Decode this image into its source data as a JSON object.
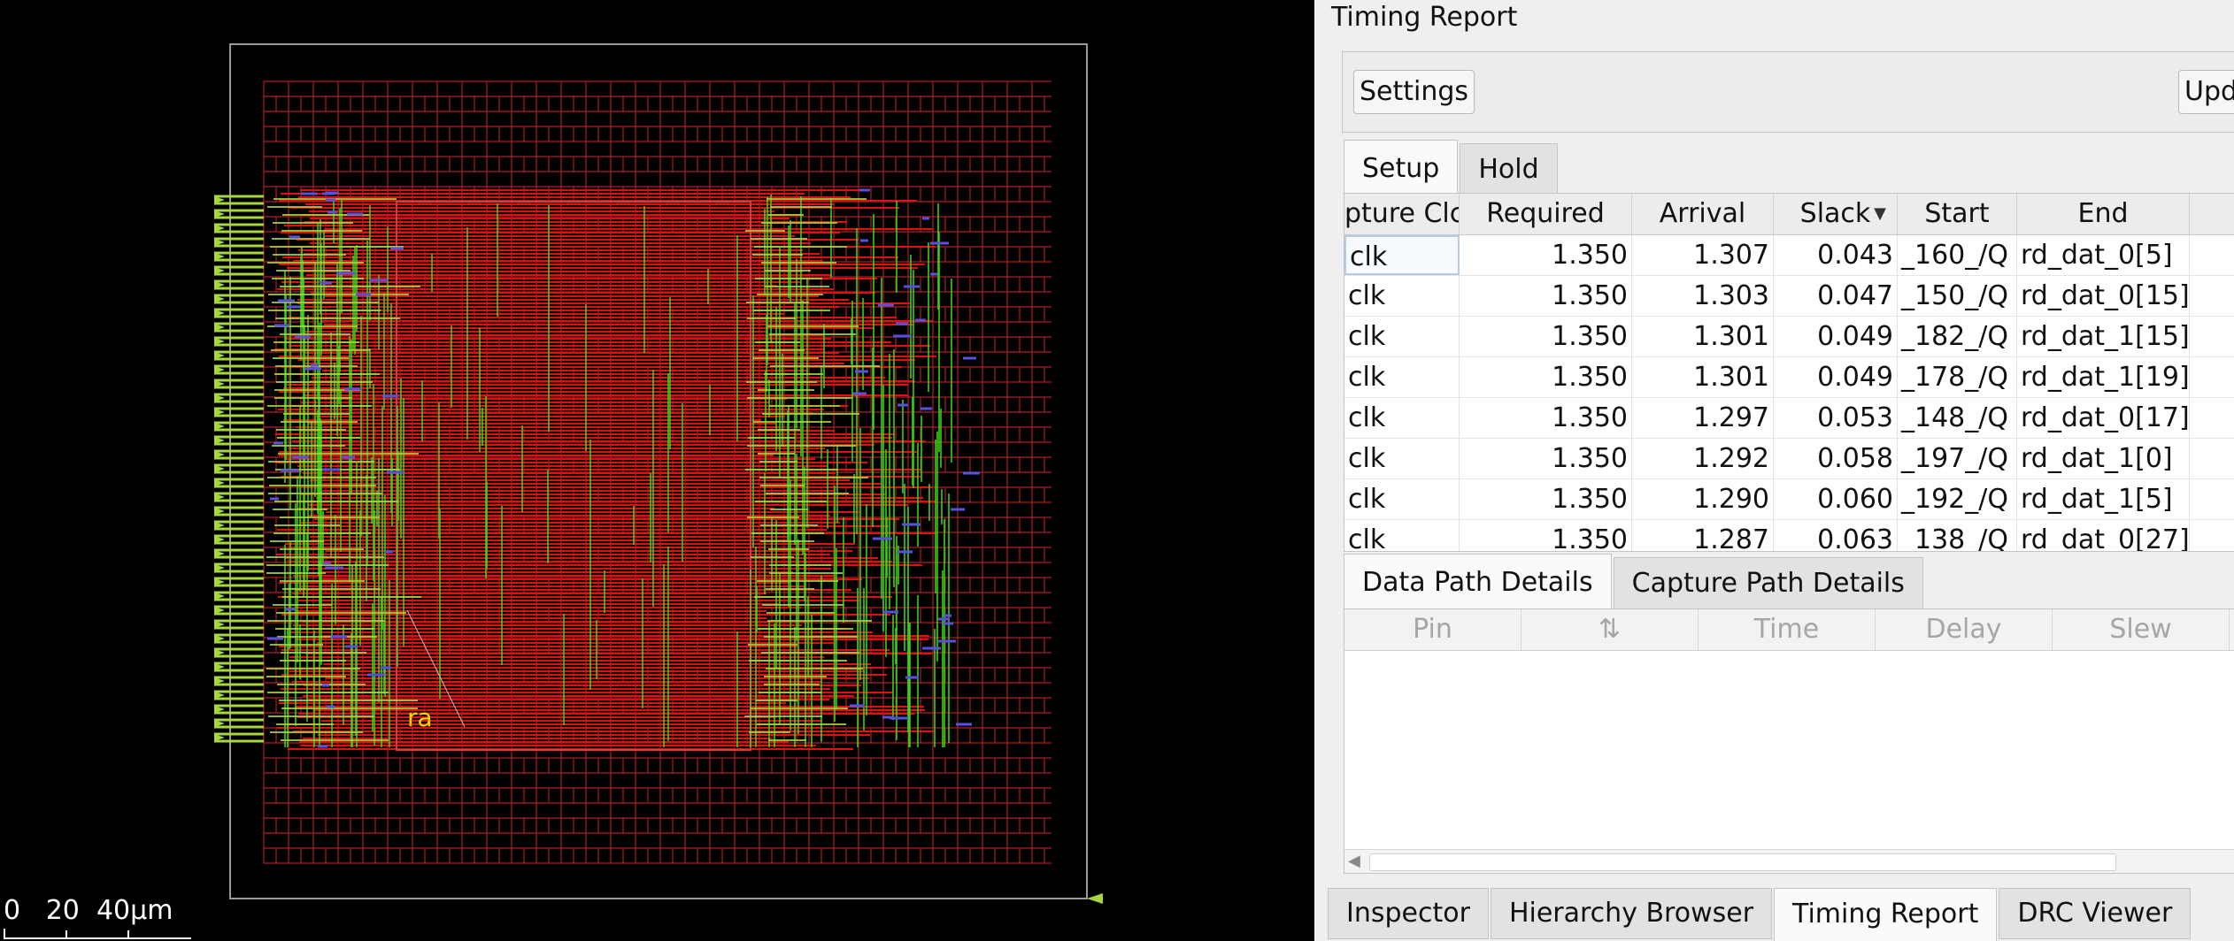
{
  "layout_view": {
    "label_text": "ra",
    "scale_label": "0   20  40μm"
  },
  "timing_report": {
    "title": "Timing Report",
    "settings_label": "Settings",
    "update_label": "Updat",
    "path_tabs": [
      {
        "label": "Setup",
        "active": true
      },
      {
        "label": "Hold",
        "active": false
      }
    ],
    "columns": [
      "pture Clc",
      "Required",
      "Arrival",
      "Slack",
      "Start",
      "End"
    ],
    "rows": [
      {
        "clock": "clk",
        "required": "1.350",
        "arrival": "1.307",
        "slack": "0.043",
        "start": "_160_/Q",
        "end": "rd_dat_0[5]"
      },
      {
        "clock": "clk",
        "required": "1.350",
        "arrival": "1.303",
        "slack": "0.047",
        "start": "_150_/Q",
        "end": "rd_dat_0[15]"
      },
      {
        "clock": "clk",
        "required": "1.350",
        "arrival": "1.301",
        "slack": "0.049",
        "start": "_182_/Q",
        "end": "rd_dat_1[15]"
      },
      {
        "clock": "clk",
        "required": "1.350",
        "arrival": "1.301",
        "slack": "0.049",
        "start": "_178_/Q",
        "end": "rd_dat_1[19]"
      },
      {
        "clock": "clk",
        "required": "1.350",
        "arrival": "1.297",
        "slack": "0.053",
        "start": "_148_/Q",
        "end": "rd_dat_0[17]"
      },
      {
        "clock": "clk",
        "required": "1.350",
        "arrival": "1.292",
        "slack": "0.058",
        "start": "_197_/Q",
        "end": "rd_dat_1[0]"
      },
      {
        "clock": "clk",
        "required": "1.350",
        "arrival": "1.290",
        "slack": "0.060",
        "start": "_192_/Q",
        "end": "rd_dat_1[5]"
      },
      {
        "clock": "clk",
        "required": "1.350",
        "arrival": "1.287",
        "slack": "0.063",
        "start": "_138_/Q",
        "end": "rd_dat_0[27]"
      }
    ],
    "detail_tabs": [
      {
        "label": "Data Path Details",
        "active": true
      },
      {
        "label": "Capture Path Details",
        "active": false
      }
    ],
    "detail_columns": [
      "Pin",
      "⇅",
      "Time",
      "Delay",
      "Slew"
    ]
  },
  "bottom_tabs": [
    {
      "label": "Inspector",
      "active": false
    },
    {
      "label": "Hierarchy Browser",
      "active": false
    },
    {
      "label": "Timing Report",
      "active": true
    },
    {
      "label": "DRC Viewer",
      "active": false
    }
  ],
  "colors": {
    "layout_bg": "#000000",
    "row_grid": "#c0202a",
    "metal_red": "#e01010",
    "metal_green": "#3ad01a",
    "pin_yellowgreen": "#a8d640",
    "label_yellow": "#ffd800"
  }
}
